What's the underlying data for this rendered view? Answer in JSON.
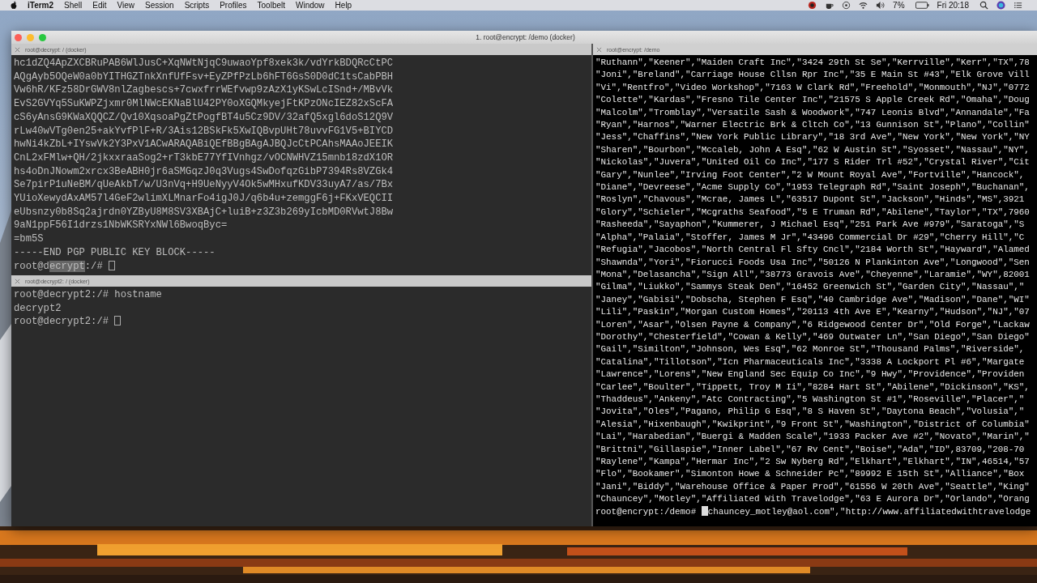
{
  "menu_bar": {
    "app": "iTerm2",
    "items": [
      "Shell",
      "Edit",
      "View",
      "Session",
      "Scripts",
      "Profiles",
      "Toolbelt",
      "Window",
      "Help"
    ],
    "battery": "7%",
    "clock": "Fri 20:18"
  },
  "window": {
    "title": "1. root@encrypt: /demo (docker)"
  },
  "columns": [
    {
      "panes": [
        {
          "title": "root@decrypt: / (docker)",
          "active": false,
          "lines": [
            "hc1dZQ4ApZXCBRuPAB6WlJusC+XqNWtNjqC9uwaoYpf8xek3k/vdYrkBDQRcCtPC",
            "AQgAyb5OQeW0a0bYITHGZTnkXnfUfFsv+EyZPfPzLb6hFT6GsS0D0dC1tsCabPBH",
            "Vw6hR/KFz58DrGWV8nlZagbescs+7cwxfrrWEfvwp9zAzX1yKSwLcISnd+/MBvVk",
            "EvS2GVYq5SuKWPZjxmr0MlNWcEKNaBlU42PY0oXGQMkyejFtKPzONcIEZ82xScFA",
            "cS6yAnsG9KWaXQQCZ/Qv10XqsoaPgZtPogfBT4u5Cz9DV/32afQ5xgl6doS12Q9V",
            "rLw40wVTg0en25+akYvfPlF+R/3Ais12BSkFk5XwIQBvpUHt78uvvFG1V5+BIYCD",
            "hwNi4kZbL+IYswVk2Y3PxV1ACwARAQABiQEfBBgBAgAJBQJcCtPCAhsMAAoJEEIK",
            "CnL2xFMlw+QH/2jkxxraaSog2+rT3kbE77YfIVnhgz/vOCNWHVZ15mnb18zdX1OR",
            "hs4oDnJNowm2xrcx3BeABH0jr6aSMGqzJ0q3Vugs4SwDofqzGibP7394Rs8VZGk4",
            "Se7pirP1uNeBM/qUeAkbT/w/U3nVq+H9UeNyyV4Ok5wMHxufKDV33uyA7/as/7Bx",
            "YUioXewydAxAM57l4GeF2wlimXLMnarFo4igJ0J/q6b4u+zemggF6j+FKxVEQCII",
            "eUbsnzy0b8Sq2ajrdn0YZByU8M8SV3XBAjC+luiB+z3Z3b269yIcbMD0RVwtJ8Bw",
            "9aN1ppF56I1drzs1NbWKSRYxNWl6BwoqByc=",
            "=bm5S",
            "-----END PGP PUBLIC KEY BLOCK-----"
          ],
          "prompt": [
            {
              "kind": "text",
              "text": "root@d"
            },
            {
              "kind": "selection",
              "text": "ecrypt"
            },
            {
              "kind": "text",
              "text": ":/# "
            },
            {
              "kind": "cursor"
            }
          ]
        },
        {
          "title": "root@decrypt2: / (docker)",
          "active": false,
          "lines": [
            "root@decrypt2:/# hostname",
            "decrypt2"
          ],
          "prompt": [
            {
              "kind": "text",
              "text": "root@decrypt2:/# "
            },
            {
              "kind": "cursor"
            }
          ]
        }
      ]
    },
    {
      "panes": [
        {
          "title": "root@encrypt: /demo",
          "active": true,
          "lines": [
            "\"Ruthann\",\"Keener\",\"Maiden Craft Inc\",\"3424 29th St Se\",\"Kerrville\",\"Kerr\",\"TX\",78",
            "\"Joni\",\"Breland\",\"Carriage House Cllsn Rpr Inc\",\"35 E Main St #43\",\"Elk Grove Vill",
            "\"Vi\",\"Rentfro\",\"Video Workshop\",\"7163 W Clark Rd\",\"Freehold\",\"Monmouth\",\"NJ\",\"0772",
            "\"Colette\",\"Kardas\",\"Fresno Tile Center Inc\",\"21575 S Apple Creek Rd\",\"Omaha\",\"Doug",
            "\"Malcolm\",\"Tromblay\",\"Versatile Sash & Woodwork\",\"747 Leonis Blvd\",\"Annandale\",\"Fa",
            "\"Ryan\",\"Harnos\",\"Warner Electric Brk & Cltch Co\",\"13 Gunnison St\",\"Plano\",\"Collin\"",
            "\"Jess\",\"Chaffins\",\"New York Public Library\",\"18 3rd Ave\",\"New York\",\"New York\",\"NY",
            "\"Sharen\",\"Bourbon\",\"Mccaleb, John A Esq\",\"62 W Austin St\",\"Syosset\",\"Nassau\",\"NY\",",
            "\"Nickolas\",\"Juvera\",\"United Oil Co Inc\",\"177 S Rider Trl #52\",\"Crystal River\",\"Cit",
            "\"Gary\",\"Nunlee\",\"Irving Foot Center\",\"2 W Mount Royal Ave\",\"Fortville\",\"Hancock\",",
            "\"Diane\",\"Devreese\",\"Acme Supply Co\",\"1953 Telegraph Rd\",\"Saint Joseph\",\"Buchanan\",",
            "\"Roslyn\",\"Chavous\",\"Mcrae, James L\",\"63517 Dupont St\",\"Jackson\",\"Hinds\",\"MS\",3921",
            "\"Glory\",\"Schieler\",\"Mcgraths Seafood\",\"5 E Truman Rd\",\"Abilene\",\"Taylor\",\"TX\",7960",
            "\"Rasheeda\",\"Sayaphon\",\"Kummerer, J Michael Esq\",\"251 Park Ave #979\",\"Saratoga\",\"S",
            "\"Alpha\",\"Palaia\",\"Stoffer, James M Jr\",\"43496 Commercial Dr #29\",\"Cherry Hill\",\"C",
            "\"Refugia\",\"Jacobos\",\"North Central Fl Sfty Cncl\",\"2184 Worth St\",\"Hayward\",\"Alamed",
            "\"Shawnda\",\"Yori\",\"Fiorucci Foods Usa Inc\",\"50126 N Plankinton Ave\",\"Longwood\",\"Sen",
            "\"Mona\",\"Delasancha\",\"Sign All\",\"38773 Gravois Ave\",\"Cheyenne\",\"Laramie\",\"WY\",82001",
            "\"Gilma\",\"Liukko\",\"Sammys Steak Den\",\"16452 Greenwich St\",\"Garden City\",\"Nassau\",\"",
            "\"Janey\",\"Gabisi\",\"Dobscha, Stephen F Esq\",\"40 Cambridge Ave\",\"Madison\",\"Dane\",\"WI\"",
            "\"Lili\",\"Paskin\",\"Morgan Custom Homes\",\"20113 4th Ave E\",\"Kearny\",\"Hudson\",\"NJ\",\"07",
            "\"Loren\",\"Asar\",\"Olsen Payne & Company\",\"6 Ridgewood Center Dr\",\"Old Forge\",\"Lackaw",
            "\"Dorothy\",\"Chesterfield\",\"Cowan & Kelly\",\"469 Outwater Ln\",\"San Diego\",\"San Diego\"",
            "\"Gail\",\"Similton\",\"Johnson, Wes Esq\",\"62 Monroe St\",\"Thousand Palms\",\"Riverside\",",
            "\"Catalina\",\"Tillotson\",\"Icn Pharmaceuticals Inc\",\"3338 A Lockport Pl #6\",\"Margate",
            "\"Lawrence\",\"Lorens\",\"New England Sec Equip Co Inc\",\"9 Hwy\",\"Providence\",\"Providen",
            "\"Carlee\",\"Boulter\",\"Tippett, Troy M Ii\",\"8284 Hart St\",\"Abilene\",\"Dickinson\",\"KS\",",
            "\"Thaddeus\",\"Ankeny\",\"Atc Contracting\",\"5 Washington St #1\",\"Roseville\",\"Placer\",\"",
            "\"Jovita\",\"Oles\",\"Pagano, Philip G Esq\",\"8 S Haven St\",\"Daytona Beach\",\"Volusia\",\"",
            "\"Alesia\",\"Hixenbaugh\",\"Kwikprint\",\"9 Front St\",\"Washington\",\"District of Columbia\"",
            "\"Lai\",\"Harabedian\",\"Buergi & Madden Scale\",\"1933 Packer Ave #2\",\"Novato\",\"Marin\",\"",
            "\"Brittni\",\"Gillaspie\",\"Inner Label\",\"67 Rv Cent\",\"Boise\",\"Ada\",\"ID\",83709,\"208-70",
            "\"Raylene\",\"Kampa\",\"Hermar Inc\",\"2 Sw Nyberg Rd\",\"Elkhart\",\"Elkhart\",\"IN\",46514,\"57",
            "\"Flo\",\"Bookamer\",\"Simonton Howe & Schneider Pc\",\"89992 E 15th St\",\"Alliance\",\"Box",
            "\"Jani\",\"Biddy\",\"Warehouse Office & Paper Prod\",\"61556 W 20th Ave\",\"Seattle\",\"King\"",
            "\"Chauncey\",\"Motley\",\"Affiliated With Travelodge\",\"63 E Aurora Dr\",\"Orlando\",\"Orang"
          ],
          "prompt": [
            {
              "kind": "text",
              "text": "root@encrypt:/demo# "
            },
            {
              "kind": "cursor"
            },
            {
              "kind": "text",
              "text": "chauncey_motley@aol.com\",\"http://www.affiliatedwithtravelodge"
            }
          ]
        }
      ]
    }
  ]
}
